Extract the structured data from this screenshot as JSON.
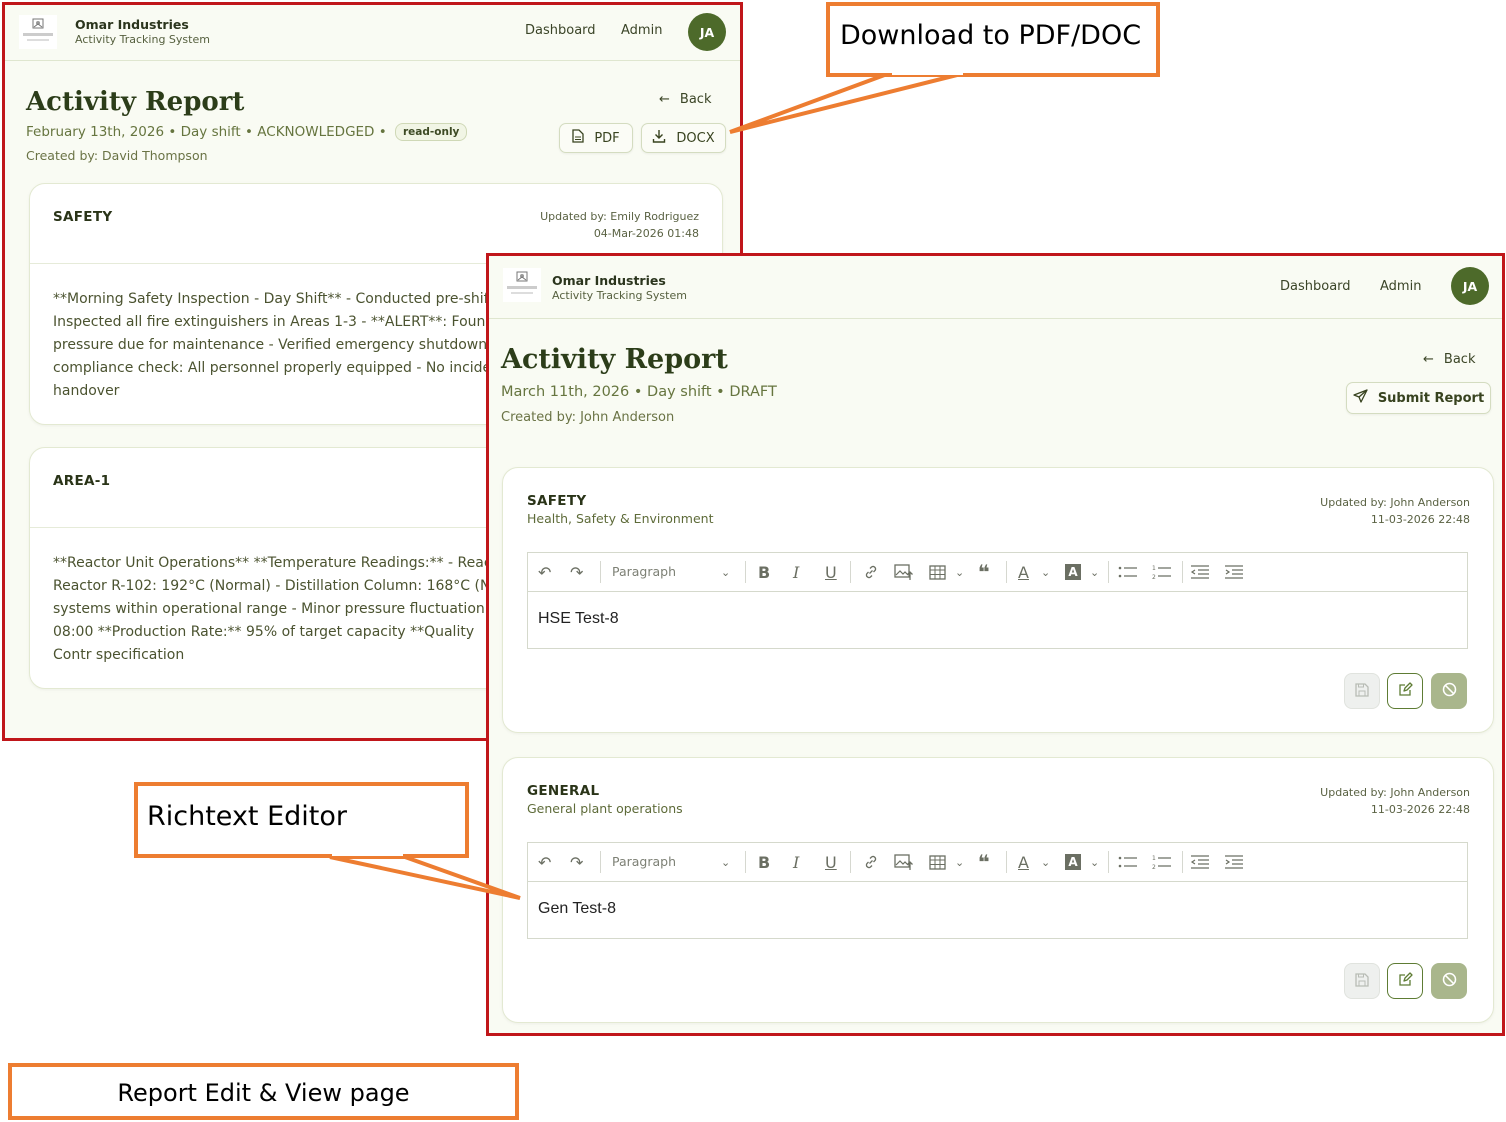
{
  "app": {
    "company": "Omar Industries",
    "subtitle": "Activity Tracking System",
    "nav": {
      "dashboard": "Dashboard",
      "admin": "Admin"
    },
    "avatar_initials": "JA",
    "logo_text": "PICTURE NOT AVAILABLE"
  },
  "view_page": {
    "title": "Activity Report",
    "meta": "February 13th, 2026 • Day shift • ACKNOWLEDGED •",
    "badge": "read-only",
    "created_by": "Created by: David Thompson",
    "back_label": "Back",
    "pdf_label": "PDF",
    "docx_label": "DOCX",
    "sections": [
      {
        "title": "SAFETY",
        "updated_by": "Updated by: Emily Rodriguez",
        "updated_at": "04-Mar-2026 01:48",
        "body": "**Morning Safety Inspection - Day Shift** - Conducted pre-shift s Inspected all fire extinguishers in Areas 1-3 - **ALERT**: Found o pressure due for maintenance - Verified emergency shutdown sy compliance check: All personnel properly equipped - No incident handover"
      },
      {
        "title": "AREA-1",
        "body": "**Reactor Unit Operations** **Temperature Readings:** - Reactor Reactor R-102: 192°C (Normal) - Distillation Column: 168°C (Norr systems within operational range - Minor pressure fluctuation no 08:00 **Production Rate:** 95% of target capacity **Quality Contr specification"
      }
    ]
  },
  "edit_page": {
    "title": "Activity Report",
    "meta": "March 11th, 2026 • Day shift • DRAFT",
    "created_by": "Created by: John Anderson",
    "back_label": "Back",
    "submit_label": "Submit Report",
    "toolbar": {
      "block_format": "Paragraph"
    },
    "sections": [
      {
        "title": "SAFETY",
        "subtitle": "Health, Safety & Environment",
        "updated_by": "Updated by: John Anderson",
        "updated_at": "11-03-2026 22:48",
        "content": "HSE Test-8"
      },
      {
        "title": "GENERAL",
        "subtitle": "General plant operations",
        "updated_by": "Updated by: John Anderson",
        "updated_at": "11-03-2026 22:48",
        "content": "Gen Test-8"
      }
    ]
  },
  "callouts": {
    "download": "Download to PDF/DOC",
    "richtext": "Richtext Editor",
    "page": "Report Edit & View page"
  },
  "colors": {
    "frame_border": "#c0161a",
    "callout_border": "#ed7d31",
    "accent_green": "#4d6a2a",
    "page_bg": "#f9fbf3"
  }
}
